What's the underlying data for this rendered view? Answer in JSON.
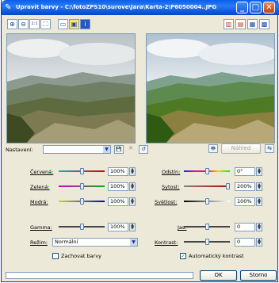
{
  "window": {
    "title": "Upravit barvy - C:\\fotoZPS10\\surove\\Jara\\Karta-2\\P6050004..JPG",
    "minimize_icon": "minimize-icon",
    "maximize_icon": "maximize-icon",
    "close_icon": "close-icon"
  },
  "toolbar": {
    "zoom_in": "⊕",
    "zoom_out": "⊖",
    "fit": "1:1",
    "full": "⛶",
    "view_a": "▭",
    "view_b": "▣",
    "info": "i",
    "right_1": "▥",
    "right_2": "▤",
    "right_3": "▦",
    "right_4": "▩"
  },
  "settings": {
    "label": "Nastavení:",
    "preset_value": "",
    "preview_label": "Náhled",
    "save_icon": "💾",
    "delete_icon": "✕",
    "reset_icon": "↺",
    "print_icon": "🖶"
  },
  "rgb": {
    "red_label": "Červená:",
    "red_value": "100%",
    "red_level": 0.5,
    "green_label": "Zelená:",
    "green_value": "100%",
    "green_level": 0.5,
    "blue_label": "Modrá:",
    "blue_value": "100%",
    "blue_level": 0.5
  },
  "hsl": {
    "hue_label": "Odstín:",
    "hue_value": "0°",
    "hue_level": 0.5,
    "sat_label": "Sytost:",
    "sat_value": "200%",
    "sat_level": 1.0,
    "light_label": "Světlost:",
    "light_value": "100%",
    "light_level": 0.5
  },
  "tone": {
    "gamma_label": "Gamma:",
    "gamma_value": "100%",
    "gamma_level": 0.5,
    "bright_label": "Jas:",
    "bright_value": "0",
    "bright_level": 0.5,
    "contrast_label": "Kontrast:",
    "contrast_value": "0",
    "contrast_level": 0.5,
    "mode_label": "Režim:",
    "mode_value": "Normální"
  },
  "options": {
    "keep_colors": "Zachovat barvy",
    "keep_colors_checked": false,
    "auto_contrast": "Automatický kontrast",
    "auto_contrast_checked": true
  },
  "footer": {
    "progress": 0.0,
    "ok_label": "OK",
    "cancel_label": "Storno"
  }
}
